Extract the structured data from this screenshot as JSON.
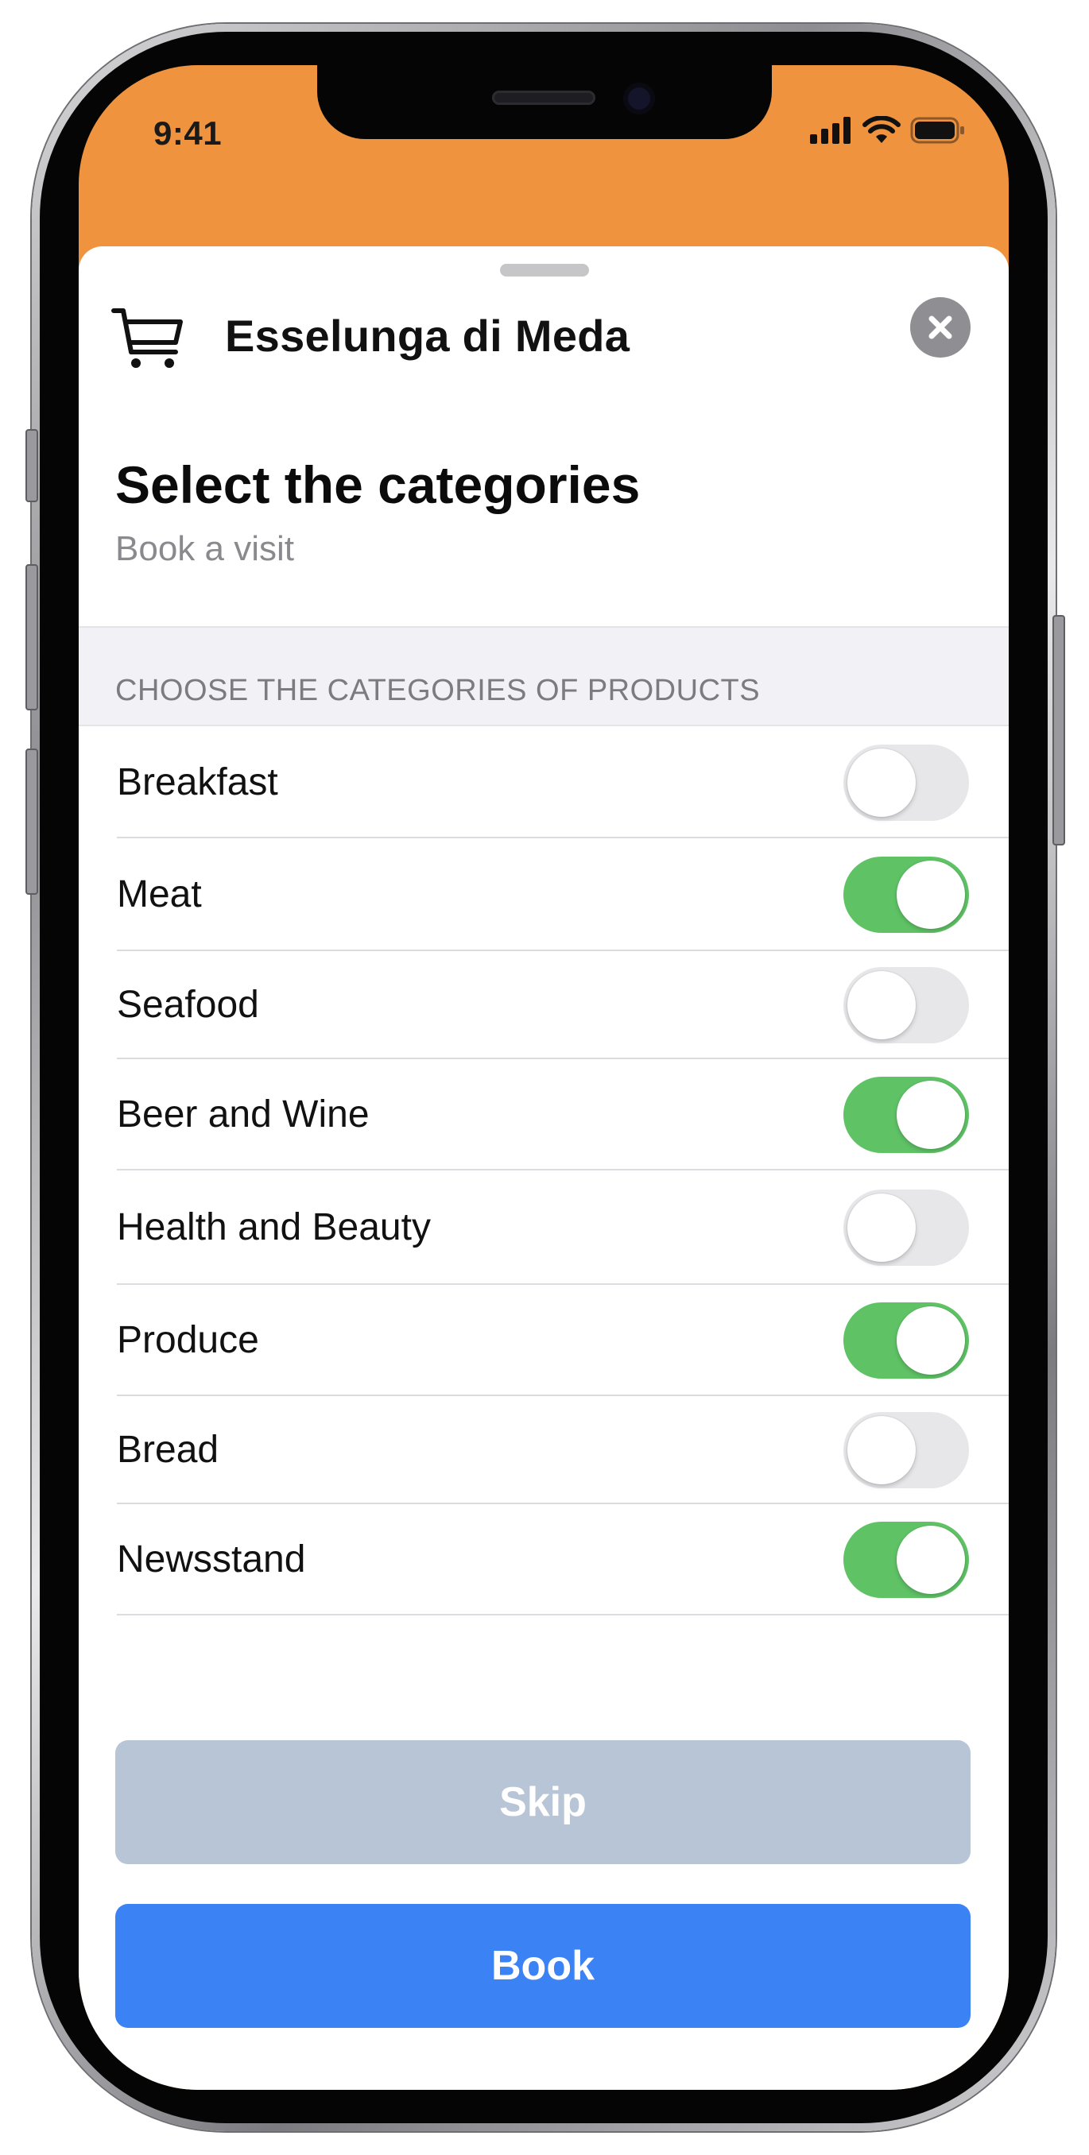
{
  "status_bar": {
    "time": "9:41"
  },
  "header": {
    "store_name": "Esselunga di Meda",
    "title": "Select the categories",
    "subtitle": "Book a visit"
  },
  "section": {
    "header": "CHOOSE THE CATEGORIES OF PRODUCTS"
  },
  "categories": [
    {
      "label": "Breakfast",
      "enabled": false
    },
    {
      "label": "Meat",
      "enabled": true
    },
    {
      "label": "Seafood",
      "enabled": false
    },
    {
      "label": "Beer and Wine",
      "enabled": true
    },
    {
      "label": "Health and Beauty",
      "enabled": false
    },
    {
      "label": "Produce",
      "enabled": true
    },
    {
      "label": "Bread",
      "enabled": false
    },
    {
      "label": "Newsstand",
      "enabled": true
    }
  ],
  "buttons": {
    "skip": "Skip",
    "book": "Book"
  },
  "colors": {
    "header_background": "#f0933f",
    "toggle_on": "#5fc366",
    "toggle_off": "#e7e7ea",
    "skip_button": "#b8c5d6",
    "book_button": "#3b82f5"
  },
  "icons": {
    "store": "cart-icon",
    "close": "close-icon"
  }
}
